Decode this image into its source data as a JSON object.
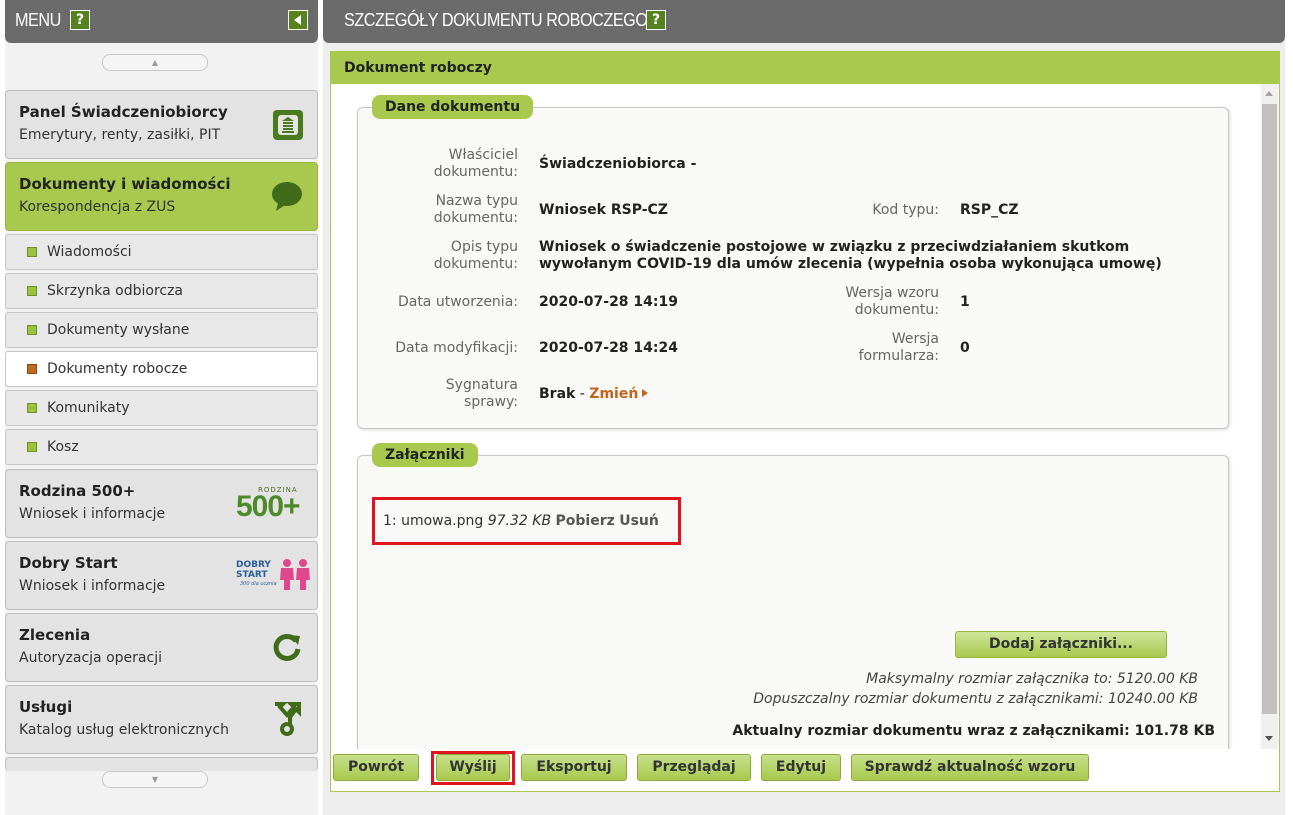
{
  "menu": {
    "title": "MENU",
    "help": "?",
    "panels": [
      {
        "title": "Panel Świadczeniobiorcy",
        "sub": "Emerytury, renty, zasiłki, PIT",
        "icon": "pillar-icon"
      },
      {
        "title": "Dokumenty i wiadomości",
        "sub": "Korespondencja z ZUS",
        "icon": "speech-bubble-icon"
      },
      {
        "title": "Rodzina 500+",
        "sub": "Wniosek i informacje",
        "icon": "rodzina-500-logo"
      },
      {
        "title": "Dobry Start",
        "sub": "Wniosek i informacje",
        "icon": "dobry-start-logo"
      },
      {
        "title": "Zlecenia",
        "sub": "Autoryzacja operacji",
        "icon": "refresh-icon"
      },
      {
        "title": "Usługi",
        "sub": "Katalog usług elektronicznych",
        "icon": "services-icon"
      }
    ],
    "sub_items": [
      {
        "label": "Wiadomości"
      },
      {
        "label": "Skrzynka odbiorcza"
      },
      {
        "label": "Dokumenty wysłane"
      },
      {
        "label": "Dokumenty robocze"
      },
      {
        "label": "Komunikaty"
      },
      {
        "label": "Kosz"
      }
    ],
    "logo_text": {
      "rodzina": "RODZINA",
      "num": "500+",
      "dobry": "DOBRY",
      "start": "START",
      "tag": "300 dla ucznia"
    }
  },
  "main": {
    "title": "SZCZEGÓŁY DOKUMENTU ROBOCZEGO",
    "help": "?",
    "box_title": "Dokument roboczy",
    "doc_section": {
      "legend": "Dane dokumentu",
      "owner_label_1": "Właściciel",
      "owner_label_2": "dokumentu:",
      "owner_value": "Świadczeniobiorca -",
      "type_name_label_1": "Nazwa typu",
      "type_name_label_2": "dokumentu:",
      "type_name_value": "Wniosek RSP-CZ",
      "type_code_label": "Kod typu:",
      "type_code_value": "RSP_CZ",
      "desc_label_1": "Opis typu",
      "desc_label_2": "dokumentu:",
      "desc_value_1": "Wniosek o świadczenie postojowe w związku z przeciwdziałaniem skutkom",
      "desc_value_2": "wywołanym COVID-19 dla umów zlecenia (wypełnia osoba wykonująca umowę)",
      "created_label": "Data utworzenia:",
      "created_value": "2020-07-28 14:19",
      "version_label_1": "Wersja wzoru",
      "version_label_2": "dokumentu:",
      "version_value": "1",
      "modified_label": "Data modyfikacji:",
      "modified_value": "2020-07-28 14:24",
      "form_version_label_1": "Wersja",
      "form_version_label_2": "formularza:",
      "form_version_value": "0",
      "signature_label_1": "Sygnatura",
      "signature_label_2": "sprawy:",
      "signature_value": "Brak",
      "signature_sep": " - ",
      "signature_link": "Zmień"
    },
    "attachments": {
      "legend": "Załączniki",
      "items": [
        {
          "index": "1:",
          "name": "umowa.png",
          "size": "97.32 KB",
          "download": "Pobierz",
          "remove": "Usuń"
        }
      ],
      "add_button": "Dodaj załączniki...",
      "max_size": "Maksymalny rozmiar załącznika to: 5120.00 KB",
      "allowed_size": "Dopuszczalny rozmiar dokumentu z załącznikami: 10240.00 KB",
      "current_size": "Aktualny rozmiar dokumentu wraz z załącznikami: 101.78 KB"
    },
    "buttons": {
      "back": "Powrót",
      "send": "Wyślij",
      "export": "Eksportuj",
      "browse": "Przeglądaj",
      "edit": "Edytuj",
      "check": "Sprawdź aktualność wzoru"
    }
  },
  "colors": {
    "accent_green": "#a8c94e",
    "header_gray": "#6b6b6b",
    "highlight_red": "#e0141e",
    "link_orange": "#c0651b"
  }
}
